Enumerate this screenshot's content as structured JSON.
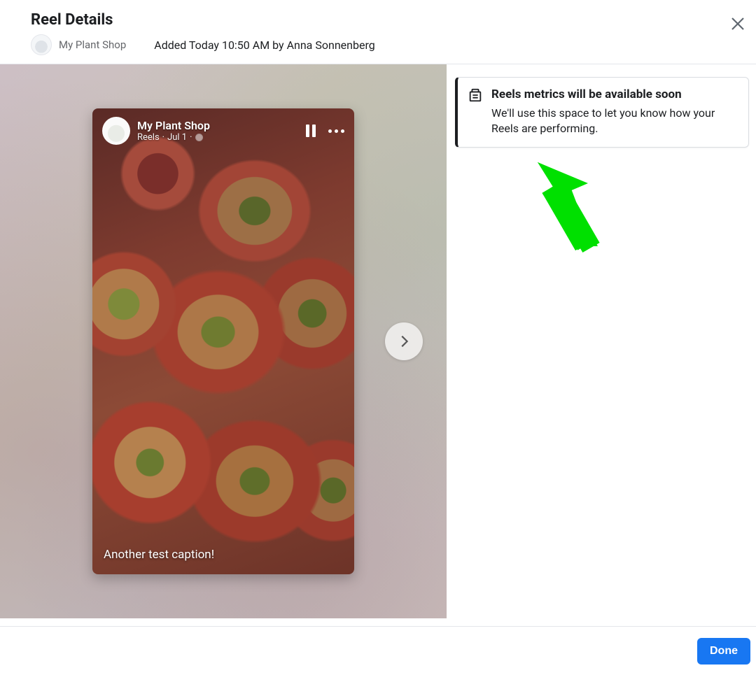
{
  "header": {
    "title": "Reel Details",
    "shop_name": "My Plant Shop",
    "added_by": "Added Today 10:50 AM by Anna Sonnenberg"
  },
  "reel": {
    "account_name": "My Plant Shop",
    "subline_type": "Reels",
    "subline_date": "Jul 1",
    "caption": "Another test caption!"
  },
  "info": {
    "title": "Reels metrics will be available soon",
    "description": "We'll use this space to let you know how your Reels are performing."
  },
  "footer": {
    "done_label": "Done"
  }
}
